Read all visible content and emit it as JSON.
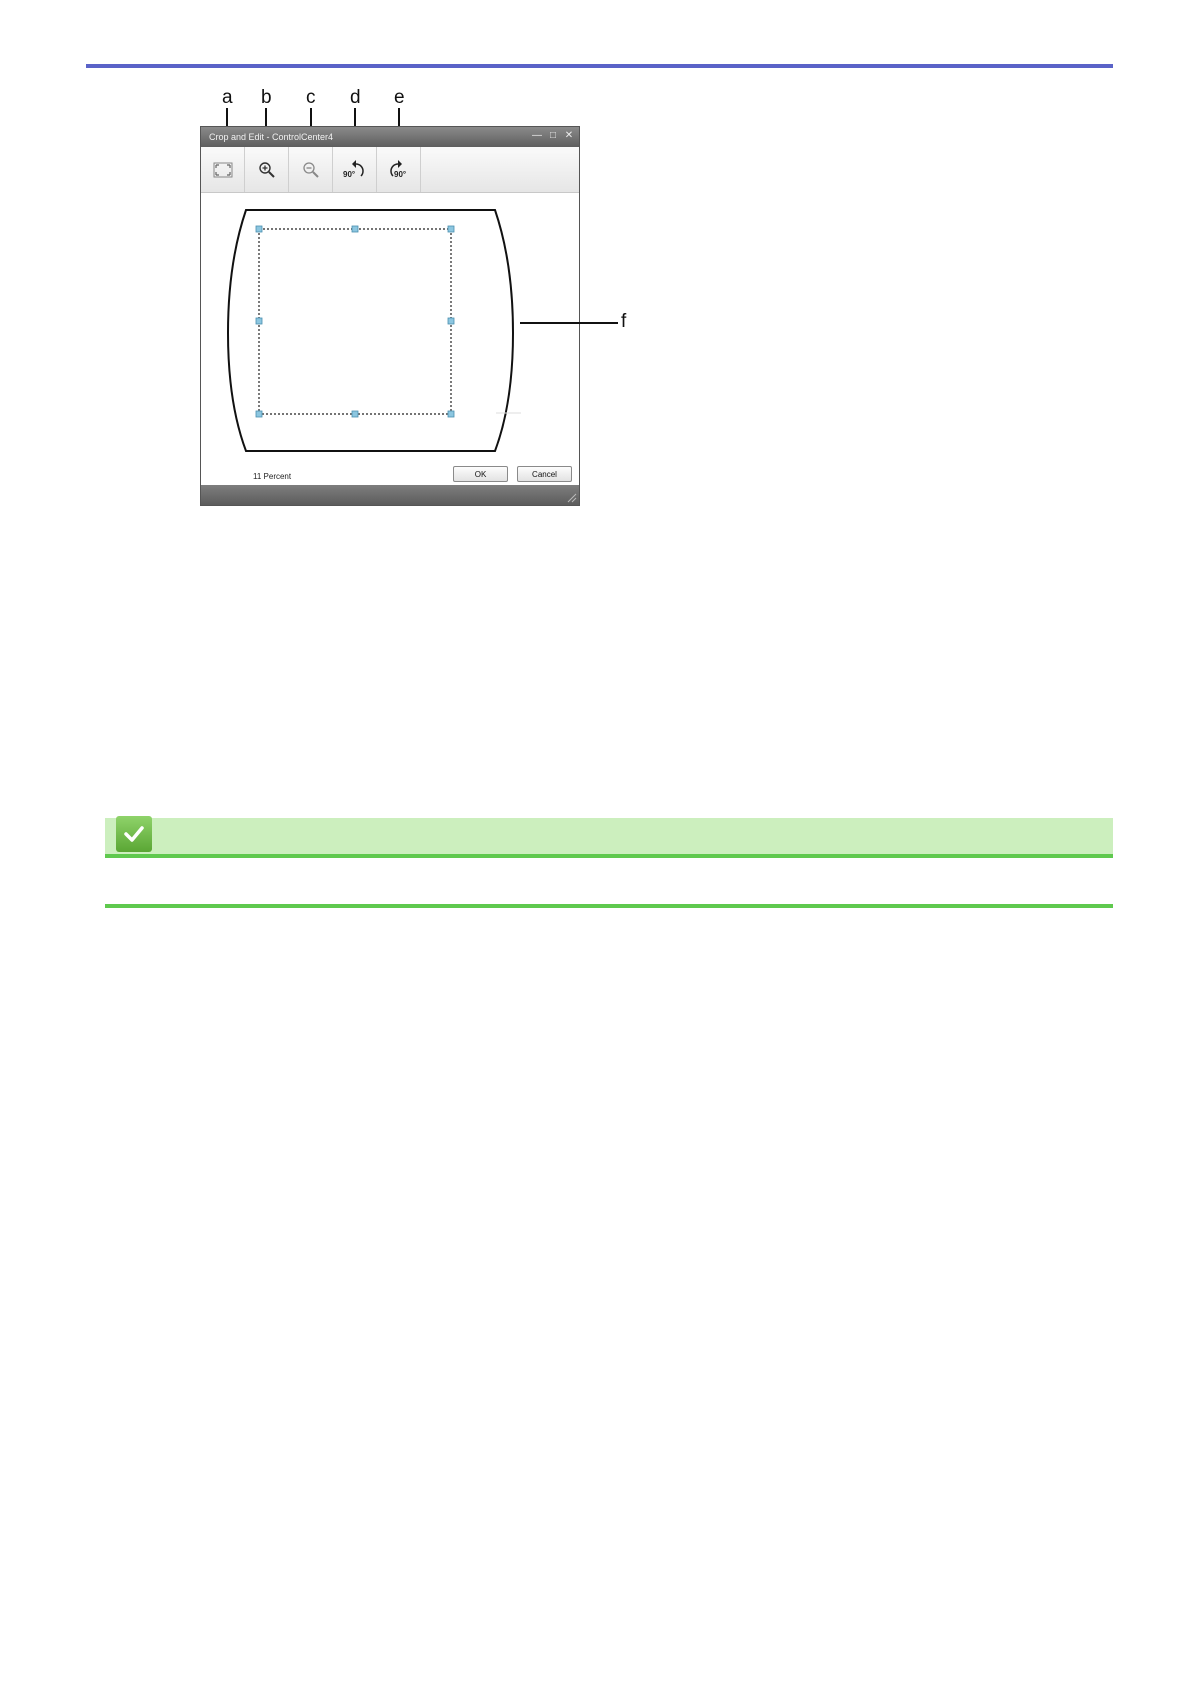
{
  "window": {
    "title": "Crop and Edit - ControlCenter4"
  },
  "callouts": {
    "a": "a",
    "b": "b",
    "c": "c",
    "d": "d",
    "e": "e",
    "f": "f"
  },
  "toolbar": {
    "rotate_left_label": "90°",
    "rotate_right_label": "90°"
  },
  "status": {
    "zoom_text": "11 Percent"
  },
  "buttons": {
    "ok": "OK",
    "cancel": "Cancel"
  },
  "colors": {
    "top_rule": "#5a63c8",
    "green_bar": "#ccefbe",
    "green_rule": "#5fc94e"
  }
}
